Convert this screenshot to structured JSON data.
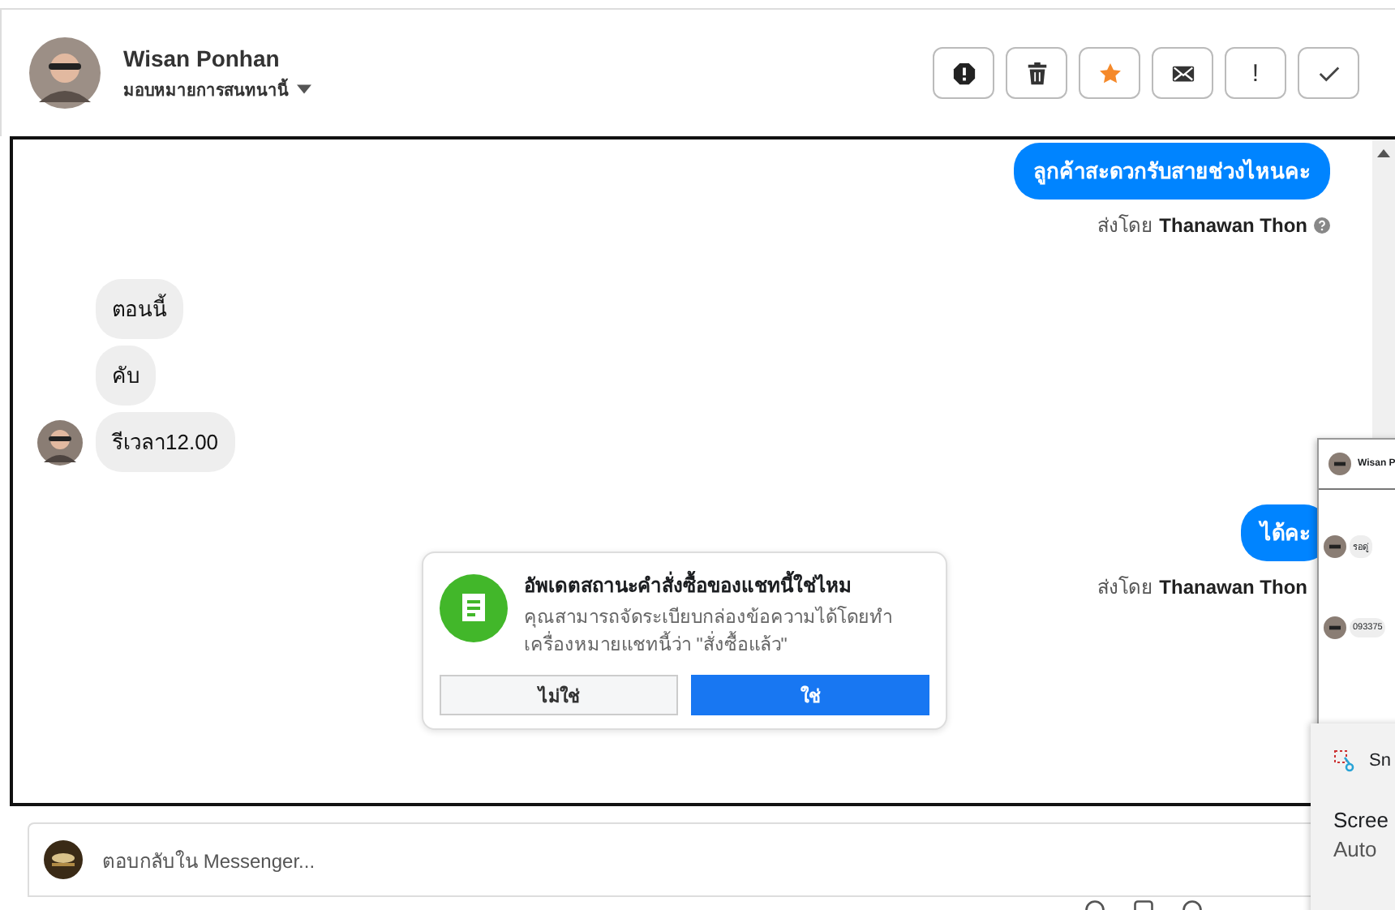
{
  "header": {
    "name": "Wisan Ponhan",
    "assign_label": "มอบหมายการสนทนานี้"
  },
  "actions": [
    {
      "kind": "alert"
    },
    {
      "kind": "trash"
    },
    {
      "kind": "star",
      "on": true
    },
    {
      "kind": "mail"
    },
    {
      "kind": "exclaim",
      "label": "!"
    },
    {
      "kind": "check"
    }
  ],
  "messages": [
    {
      "kind": "out",
      "text": "ลูกค้าสะดวกรับสายช่วงไหนคะ",
      "sent_by": "ส่งโดย",
      "sender": "Thanawan Thon",
      "help": true
    },
    {
      "kind": "in",
      "text": "ตอนนี้",
      "avatar": false
    },
    {
      "kind": "in",
      "text": "คับ",
      "avatar": false
    },
    {
      "kind": "in",
      "text": "รีเวลา12.00",
      "avatar": true
    },
    {
      "kind": "out",
      "text": "ได้คะ",
      "sent_by": "ส่งโดย",
      "sender": "Thanawan Thon",
      "help": false
    }
  ],
  "prompt": {
    "title": "อัพเดตสถานะคำสั่งซื้อของแชทนี้ใช่ไหม",
    "body": "คุณสามารถจัดระเบียบกล่องข้อความได้โดยทำเครื่องหมายแชทนี้ว่า \"สั่งซื้อแล้ว\"",
    "buttons": [
      {
        "label": "ไม่ใช่",
        "primary": false
      },
      {
        "label": "ใช่",
        "primary": true
      }
    ]
  },
  "composer": {
    "placeholder": "ตอบกลับใน Messenger..."
  },
  "snip_preview": {
    "name": "Wisan P",
    "messages": [
      "รอดู่",
      "093375"
    ]
  },
  "snip_toast": {
    "app": "Sn",
    "title": "Scree",
    "body": "Auto"
  }
}
